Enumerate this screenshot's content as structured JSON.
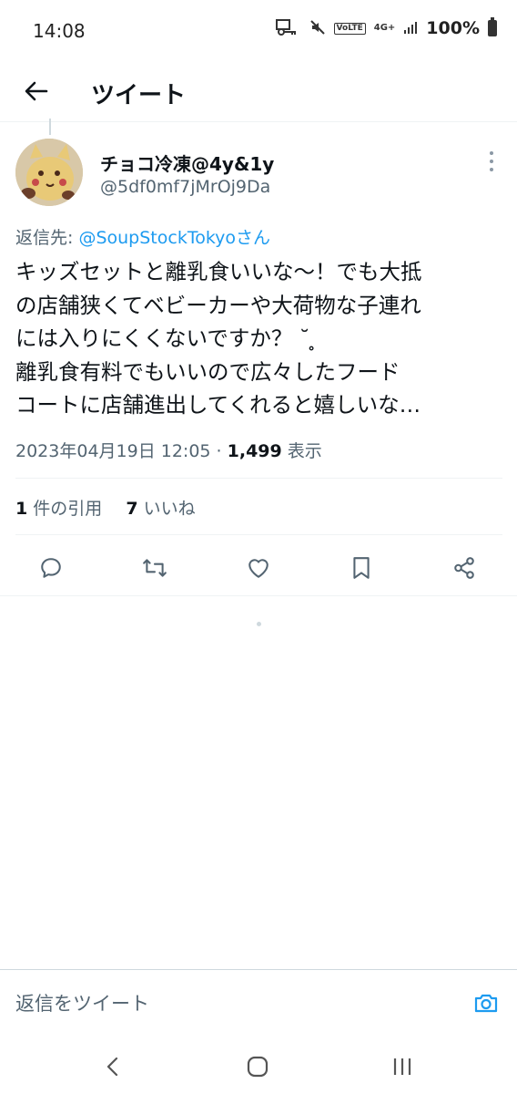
{
  "status_bar": {
    "time": "14:08",
    "network_type": "4G+",
    "volte_label": "VoLTE",
    "battery_percent": "100%"
  },
  "header": {
    "title": "ツイート",
    "back_icon": "arrow-left-icon"
  },
  "tweet": {
    "display_name": "チョコ冷凍@4y&1y",
    "handle": "@5df0mf7jMrOj9Da",
    "reply_to_prefix": "返信先: ",
    "reply_to_mention": "@SoupStockTokyoさん",
    "text_lines": [
      "キッズセットと離乳食いいな〜！でも大抵",
      "の店舗狭くてベビーカーや大荷物な子連れ",
      "には入りにくくないですか？ ˘ ̥",
      "離乳食有料でもいいので広々したフード",
      "コートに店舗進出してくれると嬉しいな…"
    ],
    "timestamp": "2023年04月19日 12:05",
    "separator": " · ",
    "views_count": "1,499",
    "views_label": " 表示",
    "quote_count": "1",
    "quote_label": " 件の引用",
    "like_count": "7",
    "like_label": " いいね"
  },
  "actions": [
    "reply-icon",
    "retweet-icon",
    "like-icon",
    "bookmark-icon",
    "share-icon"
  ],
  "reply_bar": {
    "placeholder": "返信をツイート",
    "camera_icon": "camera-icon"
  },
  "nav": [
    "back-nav-icon",
    "home-nav-icon",
    "recents-nav-icon"
  ],
  "colors": {
    "accent": "#1d9bf0",
    "text_primary": "#0f1419",
    "text_secondary": "#536471"
  }
}
